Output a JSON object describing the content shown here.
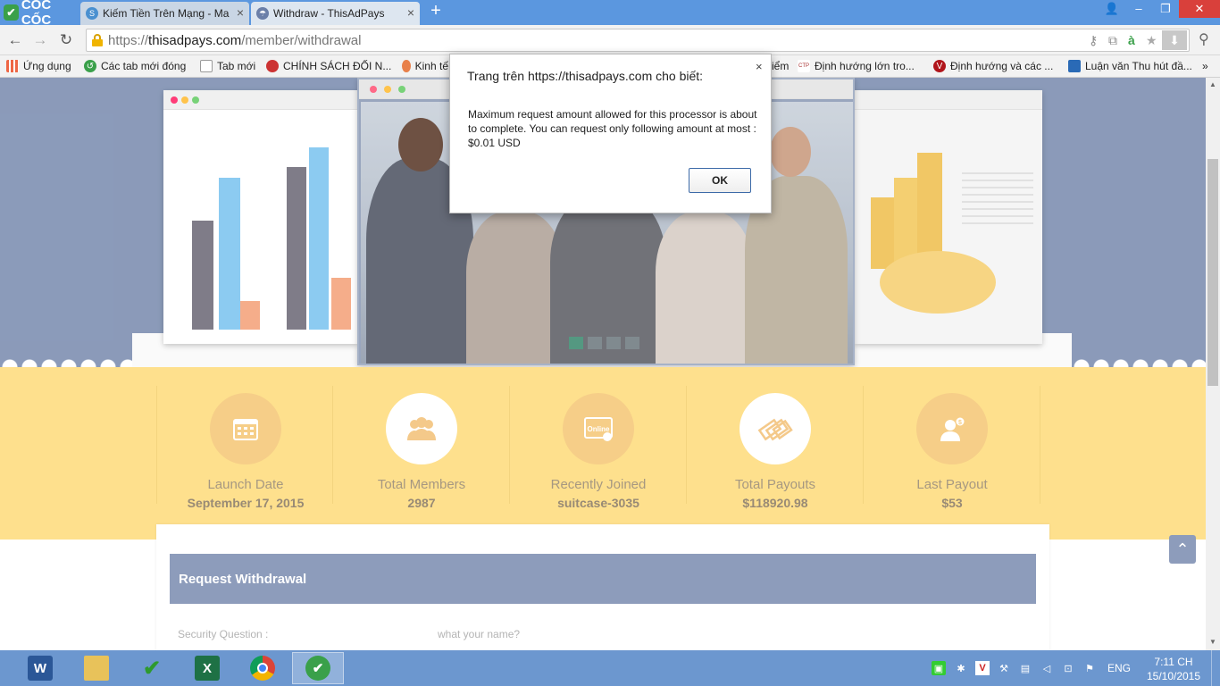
{
  "browser": {
    "logo_text": "CỐC CỐC",
    "tabs": [
      {
        "title": "Kiếm Tiền Trên Mạng - Ma",
        "active": false
      },
      {
        "title": "Withdraw - ThisAdPays",
        "active": true
      }
    ],
    "new_tab": "+",
    "url_prefix": "https://",
    "url_domain": "thisadpays.com",
    "url_path": "/member/withdrawal",
    "bookmarks": [
      "Ứng dụng",
      "Các tab mới đóng",
      "Tab mới",
      "CHÍNH SÁCH ĐỐI N...",
      "Kinh tế",
      "iểm",
      "Định hướng lớn tro...",
      "Định hướng và các ...",
      "Luận văn Thu hút đầ..."
    ],
    "bookmarks_more": "»"
  },
  "stats": [
    {
      "label": "Launch Date",
      "value": "September 17, 2015",
      "icon": "calendar-icon"
    },
    {
      "label": "Total Members",
      "value": "2987",
      "icon": "members-icon"
    },
    {
      "label": "Recently Joined",
      "value": "suitcase-3035",
      "icon": "online-icon"
    },
    {
      "label": "Total Payouts",
      "value": "$118920.98",
      "icon": "money-icon"
    },
    {
      "label": "Last Payout",
      "value": "$53",
      "icon": "payout-icon"
    }
  ],
  "withdrawal": {
    "header": "Request Withdrawal",
    "security_label": "Security Question :",
    "security_value": "what your name?"
  },
  "slider": {
    "pages": 4,
    "active_index": 0
  },
  "dialog": {
    "title": "Trang trên https://thisadpays.com cho biết:",
    "message": "Maximum request amount allowed for this processor is about to complete. You can request only following amount at most : $0.01 USD",
    "ok": "OK",
    "close": "×"
  },
  "taskbar": {
    "apps": [
      "word-icon",
      "explorer-icon",
      "tick-icon",
      "excel-icon",
      "chrome-icon",
      "coccoc-icon"
    ],
    "language": "ENG",
    "time": "7:11 CH",
    "date": "15/10/2015"
  },
  "colors": {
    "hero_bg": "#7b8db0",
    "stats_bg": "#fedc7e",
    "header_bg": "#7e8fb2",
    "taskbar": "#6c97cf",
    "tabbar": "#5b97df"
  }
}
